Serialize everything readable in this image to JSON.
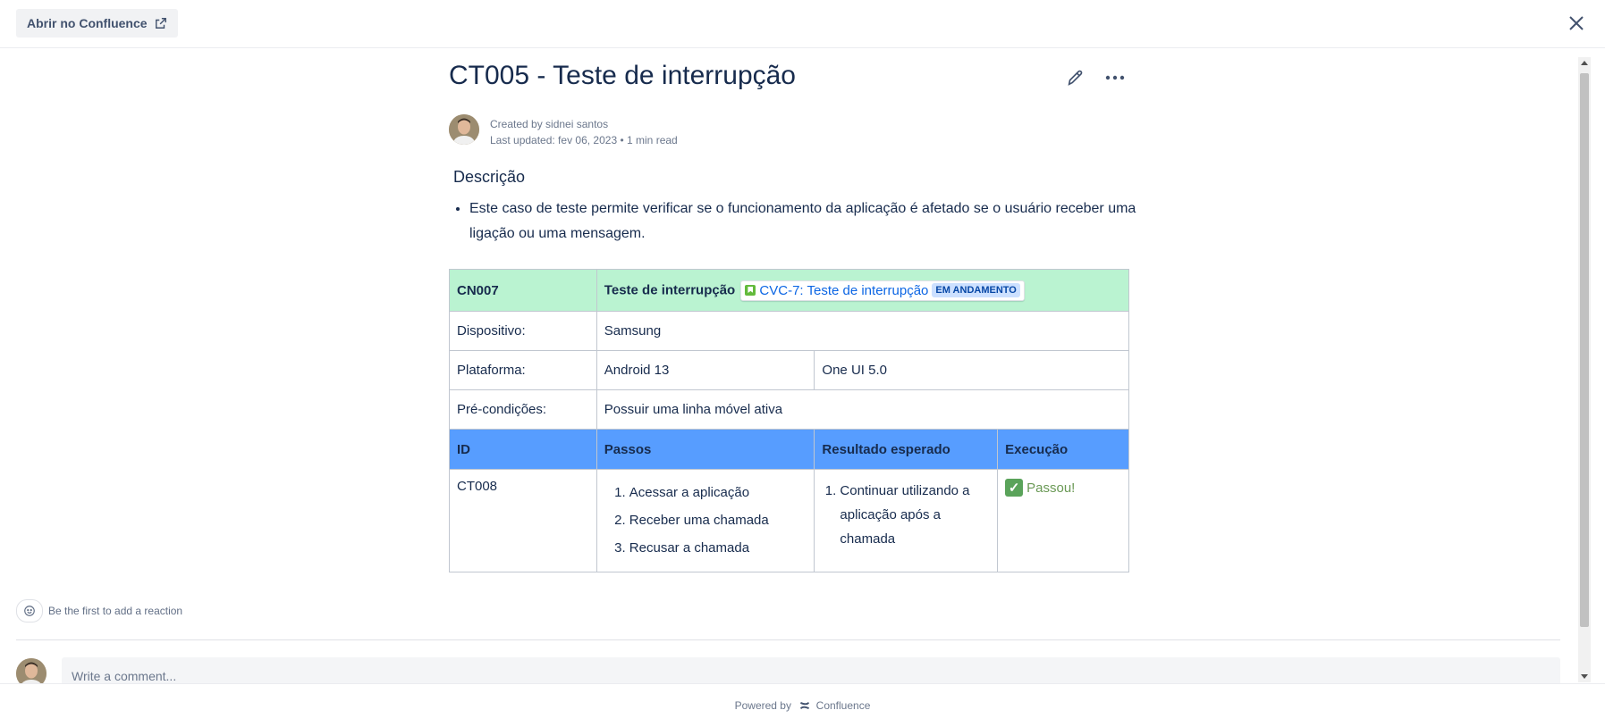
{
  "topbar": {
    "open_label": "Abrir no Confluence",
    "open_icon": "external-link-icon",
    "close_icon": "close-icon"
  },
  "page": {
    "title": "CT005 - Teste de interrupção",
    "created_by": "Created by sidnei santos",
    "last_updated": "Last updated: fev 06, 2023",
    "read_time": "1 min read",
    "section_heading": "Descrição",
    "description": "Este caso de teste permite verificar se o funcionamento da aplicação é afetado se o usuário receber uma ligação ou uma mensagem."
  },
  "table": {
    "header": {
      "id": "CN007",
      "title": "Teste de interrupção",
      "issue_key": "CVC-7: Teste de interrupção",
      "issue_status": "EM ANDAMENTO"
    },
    "rows": [
      {
        "label": "Dispositivo:",
        "value": "Samsung"
      },
      {
        "label": "Plataforma:",
        "value": "Android 13",
        "value2": "One UI 5.0"
      },
      {
        "label": "Pré-condições:",
        "value": "Possuir uma linha móvel ativa"
      }
    ],
    "columns": [
      "ID",
      "Passos",
      "Resultado esperado",
      "Execução"
    ],
    "case": {
      "id": "CT008",
      "steps": [
        "Acessar a aplicação",
        "Receber uma chamada",
        "Recusar a chamada"
      ],
      "expected": [
        "Continuar utilizando a aplicação após a chamada"
      ],
      "execution": "Passou!"
    }
  },
  "reactions": {
    "label": "Be the first to add a reaction"
  },
  "comment": {
    "placeholder": "Write a comment..."
  },
  "footer": {
    "powered_by": "Powered by",
    "brand": "Confluence"
  },
  "colors": {
    "header_row": "#baf3d1",
    "column_header_row": "#579dff",
    "status_lozenge": "#cce0ff",
    "pass_check": "#5aa35a"
  }
}
